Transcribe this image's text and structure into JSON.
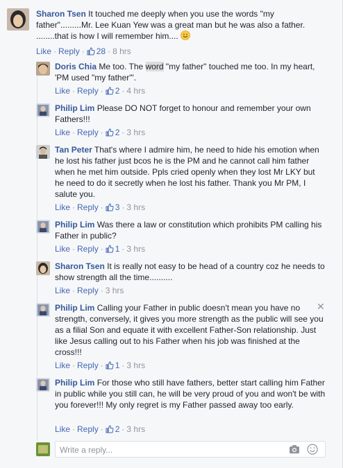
{
  "comments": [
    {
      "author": "Sharon Tsen",
      "text": "It touched me deeply when you use the words \"my father\".........Mr. Lee Kuan Yew was a great man but he was also a father. ........that is how I will remember him....",
      "like": "Like",
      "reply": "Reply",
      "likes": "28",
      "time": "8 hrs"
    }
  ],
  "replies": [
    {
      "author": "Doris Chia",
      "text_before": "Me too. The ",
      "text_highlight": "word",
      "text_after": " \"my father\" touched me too. In my heart, 'PM used \"my father\"'.",
      "like": "Like",
      "reply": "Reply",
      "likes": "2",
      "time": "4 hrs"
    },
    {
      "author": "Philip Lim",
      "text": "Please DO NOT forget to honour and remember your own Fathers!!!",
      "like": "Like",
      "reply": "Reply",
      "likes": "2",
      "time": "3 hrs"
    },
    {
      "author": "Tan Peter",
      "text": "That's where I admire him, he need to hide his emotion when he lost his father just bcos he is the PM and he cannot call him father when he met him outside. Ppls cried openly when they lost Mr LKY but he need to do it secretly when he lost his father. Thank you Mr PM, I salute you.",
      "like": "Like",
      "reply": "Reply",
      "likes": "3",
      "time": "3 hrs"
    },
    {
      "author": "Philip Lim",
      "text": "Was there a law or constitution which prohibits PM calling his Father in public?",
      "like": "Like",
      "reply": "Reply",
      "likes": "1",
      "time": "3 hrs"
    },
    {
      "author": "Sharon Tsen",
      "text": "It is really not easy to be head of a country coz he needs to show strength all the time..........",
      "like": "Like",
      "reply": "Reply",
      "likes": "",
      "time": "3 hrs"
    },
    {
      "author": "Philip Lim",
      "text": "Calling your Father in public doesn't mean you have no strength, conversely, it gives you more strength as the public will see you as a filial Son and equate it with excellent Father-Son relationship. Just like Jesus calling out to his Father when his job was finished at the cross!!!",
      "like": "Like",
      "reply": "Reply",
      "likes": "1",
      "time": "3 hrs"
    },
    {
      "author": "Philip Lim",
      "text": "For those who still have fathers, better start calling him Father in public while you still can, he will be very proud of you and won't be with you forever!!! My only regret is my Father passed away too early.",
      "like": "Like",
      "reply": "Reply",
      "likes": "2",
      "time": "3 hrs"
    }
  ],
  "reply_box": {
    "placeholder": "Write a reply..."
  },
  "icons": {
    "like": "thumbs-up-icon",
    "camera": "camera-icon",
    "emoji": "smiley-icon",
    "close": "close-icon"
  },
  "colors": {
    "link": "#4267b2",
    "name": "#365899",
    "meta": "#90949c"
  }
}
